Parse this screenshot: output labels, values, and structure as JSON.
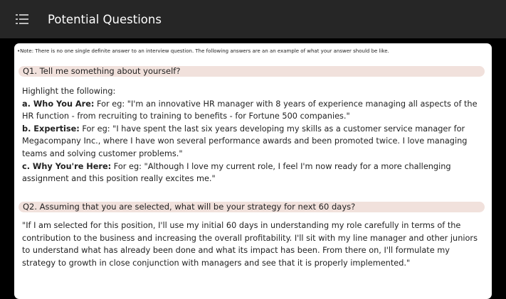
{
  "app_bar": {
    "title": "Potential Questions",
    "menu_icon": "list-menu-icon"
  },
  "note": "•Note: There is no one single definite answer to an interview question. The following answers are an an example of what your answer should be like.",
  "questions": [
    {
      "question": "Q1. Tell me something about yourself?",
      "intro": "Highlight the following:",
      "points": [
        {
          "label": "a. Who You Are:",
          "text": " For eg: \"I'm an innovative HR manager with 8 years of experience managing all aspects of the HR function - from recruiting to training to benefits - for Fortune 500 companies.\""
        },
        {
          "label": "b. Expertise:",
          "text": " For eg: \"I have spent the last six years developing my skills as a customer service manager for Megacompany Inc., where I have won several performance awards and been promoted twice. I love managing teams and solving customer problems.\""
        },
        {
          "label": "c. Why You're Here:",
          "text": " For eg: \"Although I love my current role, I feel I'm now ready for a more challenging assignment and this position really excites me.\""
        }
      ]
    },
    {
      "question": "Q2. Assuming that you are selected, what will be your strategy for next 60 days?",
      "answer": "\"If I am selected for this position, I'll use my initial 60 days in understanding my role carefully in terms of the contribution to the business and increasing the overall profitability. I'll sit with my line manager and other juniors to understand what has already been done and what its impact has been. From there on, I'll formulate my strategy to growth in close conjunction with managers and see that it is properly implemented.\""
    }
  ]
}
